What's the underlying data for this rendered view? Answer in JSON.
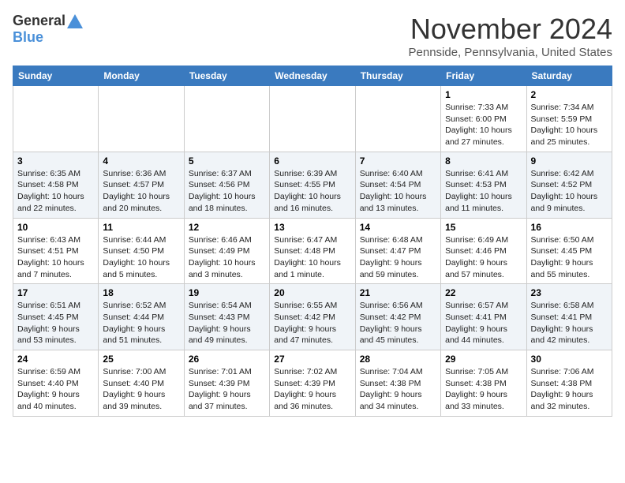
{
  "header": {
    "logo_general": "General",
    "logo_blue": "Blue",
    "month_title": "November 2024",
    "location": "Pennside, Pennsylvania, United States"
  },
  "days_of_week": [
    "Sunday",
    "Monday",
    "Tuesday",
    "Wednesday",
    "Thursday",
    "Friday",
    "Saturday"
  ],
  "weeks": [
    [
      {
        "day": "",
        "info": ""
      },
      {
        "day": "",
        "info": ""
      },
      {
        "day": "",
        "info": ""
      },
      {
        "day": "",
        "info": ""
      },
      {
        "day": "",
        "info": ""
      },
      {
        "day": "1",
        "info": "Sunrise: 7:33 AM\nSunset: 6:00 PM\nDaylight: 10 hours\nand 27 minutes."
      },
      {
        "day": "2",
        "info": "Sunrise: 7:34 AM\nSunset: 5:59 PM\nDaylight: 10 hours\nand 25 minutes."
      }
    ],
    [
      {
        "day": "3",
        "info": "Sunrise: 6:35 AM\nSunset: 4:58 PM\nDaylight: 10 hours\nand 22 minutes."
      },
      {
        "day": "4",
        "info": "Sunrise: 6:36 AM\nSunset: 4:57 PM\nDaylight: 10 hours\nand 20 minutes."
      },
      {
        "day": "5",
        "info": "Sunrise: 6:37 AM\nSunset: 4:56 PM\nDaylight: 10 hours\nand 18 minutes."
      },
      {
        "day": "6",
        "info": "Sunrise: 6:39 AM\nSunset: 4:55 PM\nDaylight: 10 hours\nand 16 minutes."
      },
      {
        "day": "7",
        "info": "Sunrise: 6:40 AM\nSunset: 4:54 PM\nDaylight: 10 hours\nand 13 minutes."
      },
      {
        "day": "8",
        "info": "Sunrise: 6:41 AM\nSunset: 4:53 PM\nDaylight: 10 hours\nand 11 minutes."
      },
      {
        "day": "9",
        "info": "Sunrise: 6:42 AM\nSunset: 4:52 PM\nDaylight: 10 hours\nand 9 minutes."
      }
    ],
    [
      {
        "day": "10",
        "info": "Sunrise: 6:43 AM\nSunset: 4:51 PM\nDaylight: 10 hours\nand 7 minutes."
      },
      {
        "day": "11",
        "info": "Sunrise: 6:44 AM\nSunset: 4:50 PM\nDaylight: 10 hours\nand 5 minutes."
      },
      {
        "day": "12",
        "info": "Sunrise: 6:46 AM\nSunset: 4:49 PM\nDaylight: 10 hours\nand 3 minutes."
      },
      {
        "day": "13",
        "info": "Sunrise: 6:47 AM\nSunset: 4:48 PM\nDaylight: 10 hours\nand 1 minute."
      },
      {
        "day": "14",
        "info": "Sunrise: 6:48 AM\nSunset: 4:47 PM\nDaylight: 9 hours\nand 59 minutes."
      },
      {
        "day": "15",
        "info": "Sunrise: 6:49 AM\nSunset: 4:46 PM\nDaylight: 9 hours\nand 57 minutes."
      },
      {
        "day": "16",
        "info": "Sunrise: 6:50 AM\nSunset: 4:45 PM\nDaylight: 9 hours\nand 55 minutes."
      }
    ],
    [
      {
        "day": "17",
        "info": "Sunrise: 6:51 AM\nSunset: 4:45 PM\nDaylight: 9 hours\nand 53 minutes."
      },
      {
        "day": "18",
        "info": "Sunrise: 6:52 AM\nSunset: 4:44 PM\nDaylight: 9 hours\nand 51 minutes."
      },
      {
        "day": "19",
        "info": "Sunrise: 6:54 AM\nSunset: 4:43 PM\nDaylight: 9 hours\nand 49 minutes."
      },
      {
        "day": "20",
        "info": "Sunrise: 6:55 AM\nSunset: 4:42 PM\nDaylight: 9 hours\nand 47 minutes."
      },
      {
        "day": "21",
        "info": "Sunrise: 6:56 AM\nSunset: 4:42 PM\nDaylight: 9 hours\nand 45 minutes."
      },
      {
        "day": "22",
        "info": "Sunrise: 6:57 AM\nSunset: 4:41 PM\nDaylight: 9 hours\nand 44 minutes."
      },
      {
        "day": "23",
        "info": "Sunrise: 6:58 AM\nSunset: 4:41 PM\nDaylight: 9 hours\nand 42 minutes."
      }
    ],
    [
      {
        "day": "24",
        "info": "Sunrise: 6:59 AM\nSunset: 4:40 PM\nDaylight: 9 hours\nand 40 minutes."
      },
      {
        "day": "25",
        "info": "Sunrise: 7:00 AM\nSunset: 4:40 PM\nDaylight: 9 hours\nand 39 minutes."
      },
      {
        "day": "26",
        "info": "Sunrise: 7:01 AM\nSunset: 4:39 PM\nDaylight: 9 hours\nand 37 minutes."
      },
      {
        "day": "27",
        "info": "Sunrise: 7:02 AM\nSunset: 4:39 PM\nDaylight: 9 hours\nand 36 minutes."
      },
      {
        "day": "28",
        "info": "Sunrise: 7:04 AM\nSunset: 4:38 PM\nDaylight: 9 hours\nand 34 minutes."
      },
      {
        "day": "29",
        "info": "Sunrise: 7:05 AM\nSunset: 4:38 PM\nDaylight: 9 hours\nand 33 minutes."
      },
      {
        "day": "30",
        "info": "Sunrise: 7:06 AM\nSunset: 4:38 PM\nDaylight: 9 hours\nand 32 minutes."
      }
    ]
  ]
}
